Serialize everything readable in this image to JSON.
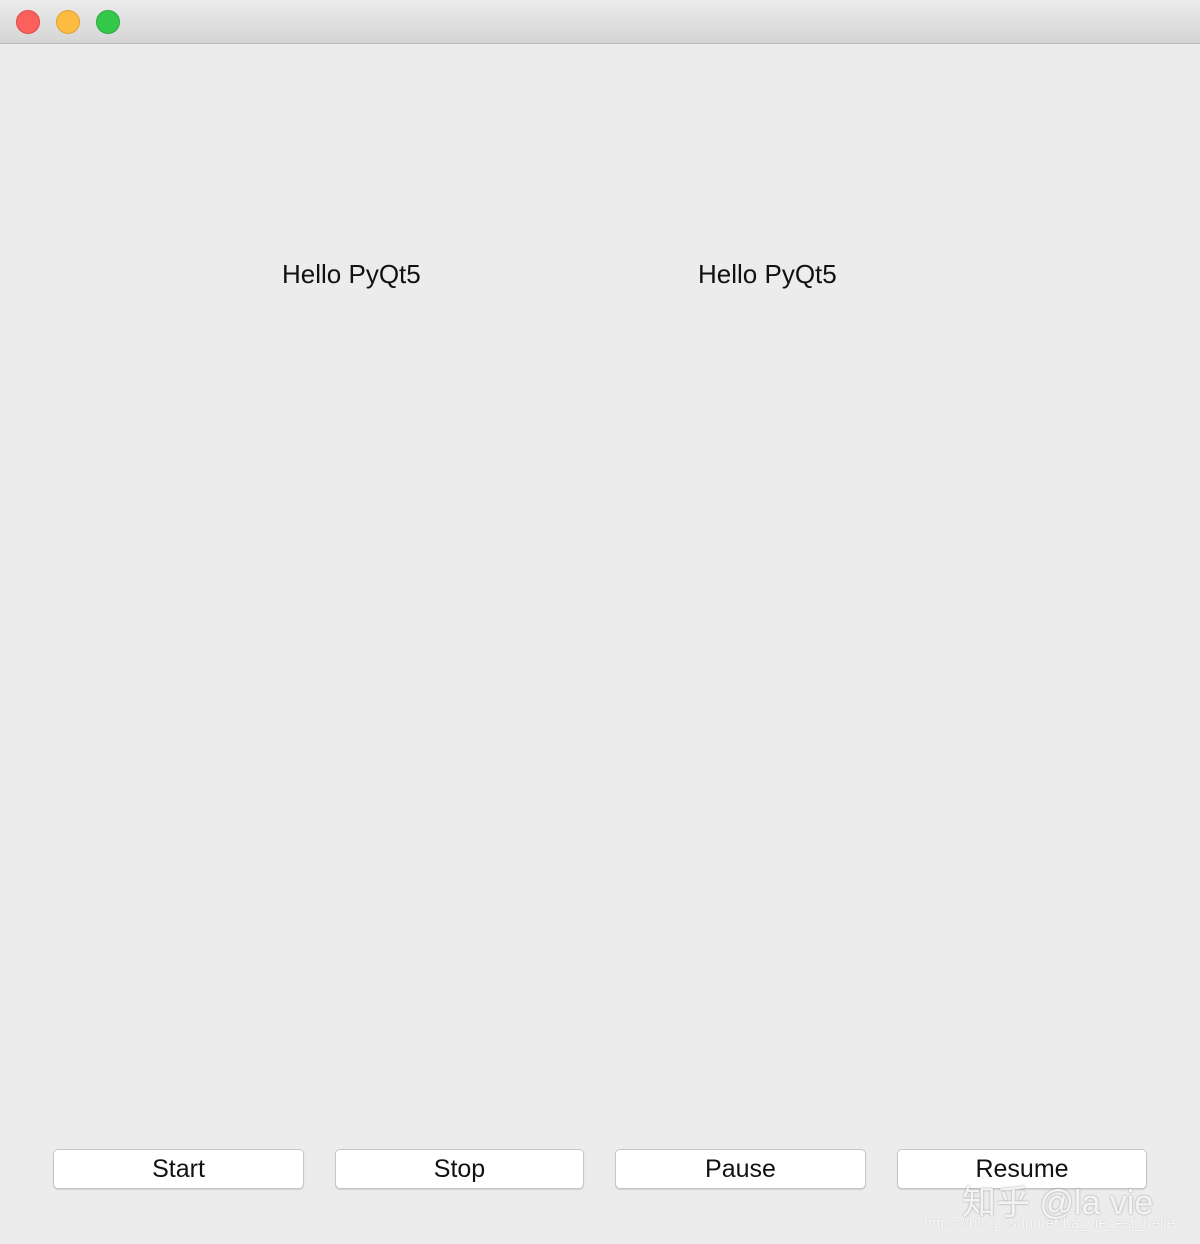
{
  "window": {
    "traffic_lights": {
      "close_color": "#fc605c",
      "minimize_color": "#fdbc40",
      "maximize_color": "#34c84a"
    }
  },
  "labels": {
    "left": "Hello PyQt5",
    "right": "Hello PyQt5"
  },
  "buttons": {
    "start": "Start",
    "stop": "Stop",
    "pause": "Pause",
    "resume": "Resume"
  },
  "watermark": {
    "text": "知乎 @la vie",
    "url": "https://blog.csdn.net/La_vie_est_belle"
  }
}
